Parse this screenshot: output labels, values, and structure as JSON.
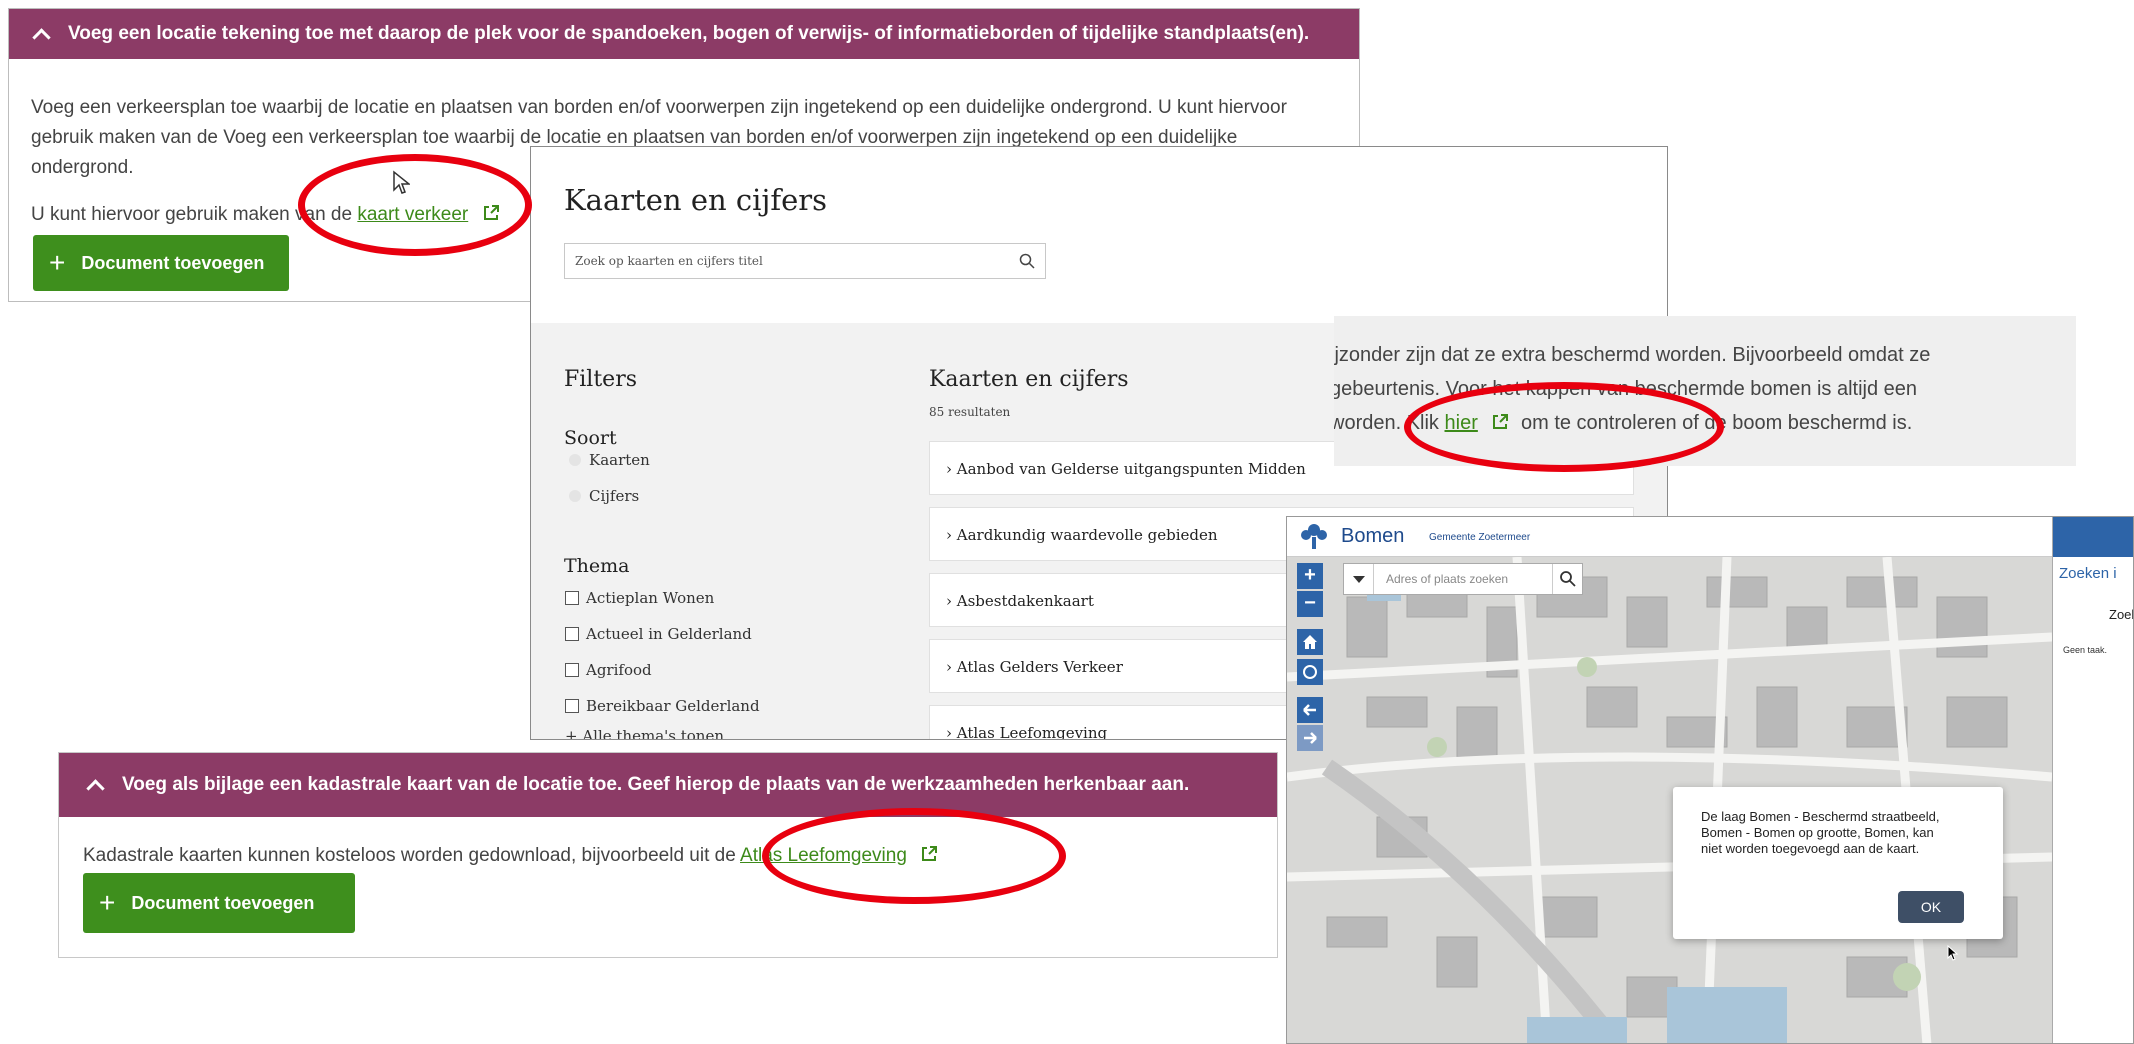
{
  "accordion_top": {
    "heading": "Voeg een locatie tekening toe met daarop de plek voor de spandoeken, bogen of verwijs- of informatieborden of tijdelijke standplaats(en).",
    "body": "Voeg een verkeersplan toe waarbij de locatie en plaatsen van borden en/of voorwerpen zijn ingetekend op een duidelijke ondergrond. U kunt hiervoor gebruik maken van de Voeg een verkeersplan toe waarbij de locatie en plaatsen van borden en/of voorwerpen zijn ingetekend op een duidelijke ondergrond.",
    "line2_prefix": "U kunt hiervoor gebruik maken van de",
    "link": "kaart verkeer",
    "button": "Document toevoegen"
  },
  "kaarten": {
    "title": "Kaarten en cijfers",
    "search_placeholder": "Zoek op kaarten en cijfers titel",
    "filters_heading": "Filters",
    "soort_heading": "Soort",
    "soort_options": [
      "Kaarten",
      "Cijfers"
    ],
    "thema_heading": "Thema",
    "thema_options": [
      "Actieplan Wonen",
      "Actueel in Gelderland",
      "Agrifood",
      "Bereikbaar Gelderland"
    ],
    "more_themes": "+ Alle thema's tonen",
    "results_heading": "Kaarten en cijfers",
    "results_count": "85 resultaten",
    "results": [
      "› Aanbod van Gelderse uitgangspunten Midden",
      "› Aardkundig waardevolle gebieden",
      "› Asbestdakenkaart",
      "› Atlas Gelders Verkeer",
      "› Atlas Leefomgeving"
    ]
  },
  "snippet": {
    "line1": "ijzonder zijn dat ze extra beschermd worden. Bijvoorbeeld omdat ze",
    "line2": "gebeurtenis. Voor het kappen van beschermde bomen is altijd een",
    "line3_prefix": "worden. Klik",
    "link": "hier",
    "line3_suffix": "om te controleren of de boom beschermd is."
  },
  "accordion_bottom": {
    "heading": "Voeg als bijlage een kadastrale kaart van de locatie toe. Geef hierop de plaats van de werkzaamheden herkenbaar aan.",
    "body_prefix": "Kadastrale kaarten kunnen kosteloos worden gedownload, bijvoorbeeld uit de",
    "link": "Atlas Leefomgeving",
    "button": "Document toevoegen"
  },
  "map": {
    "app_title": "Bomen",
    "app_subtitle": "Gemeente Zoetermeer",
    "search_placeholder": "Adres of plaats zoeken",
    "right_tab": "Zoeken i",
    "right_sub": "Zoel",
    "right_none": "Geen taak.",
    "dialog_message": "De laag Bomen - Beschermd straatbeeld, Bomen - Bomen op grootte, Bomen, kan niet worden toegevoegd aan de kaart.",
    "ok": "OK"
  },
  "colors": {
    "accordion": "#8c3b66",
    "button_green": "#3e8f1d",
    "link_green": "#3d8a1a",
    "map_blue": "#2d64a8",
    "highlight_red": "#e8000f"
  }
}
